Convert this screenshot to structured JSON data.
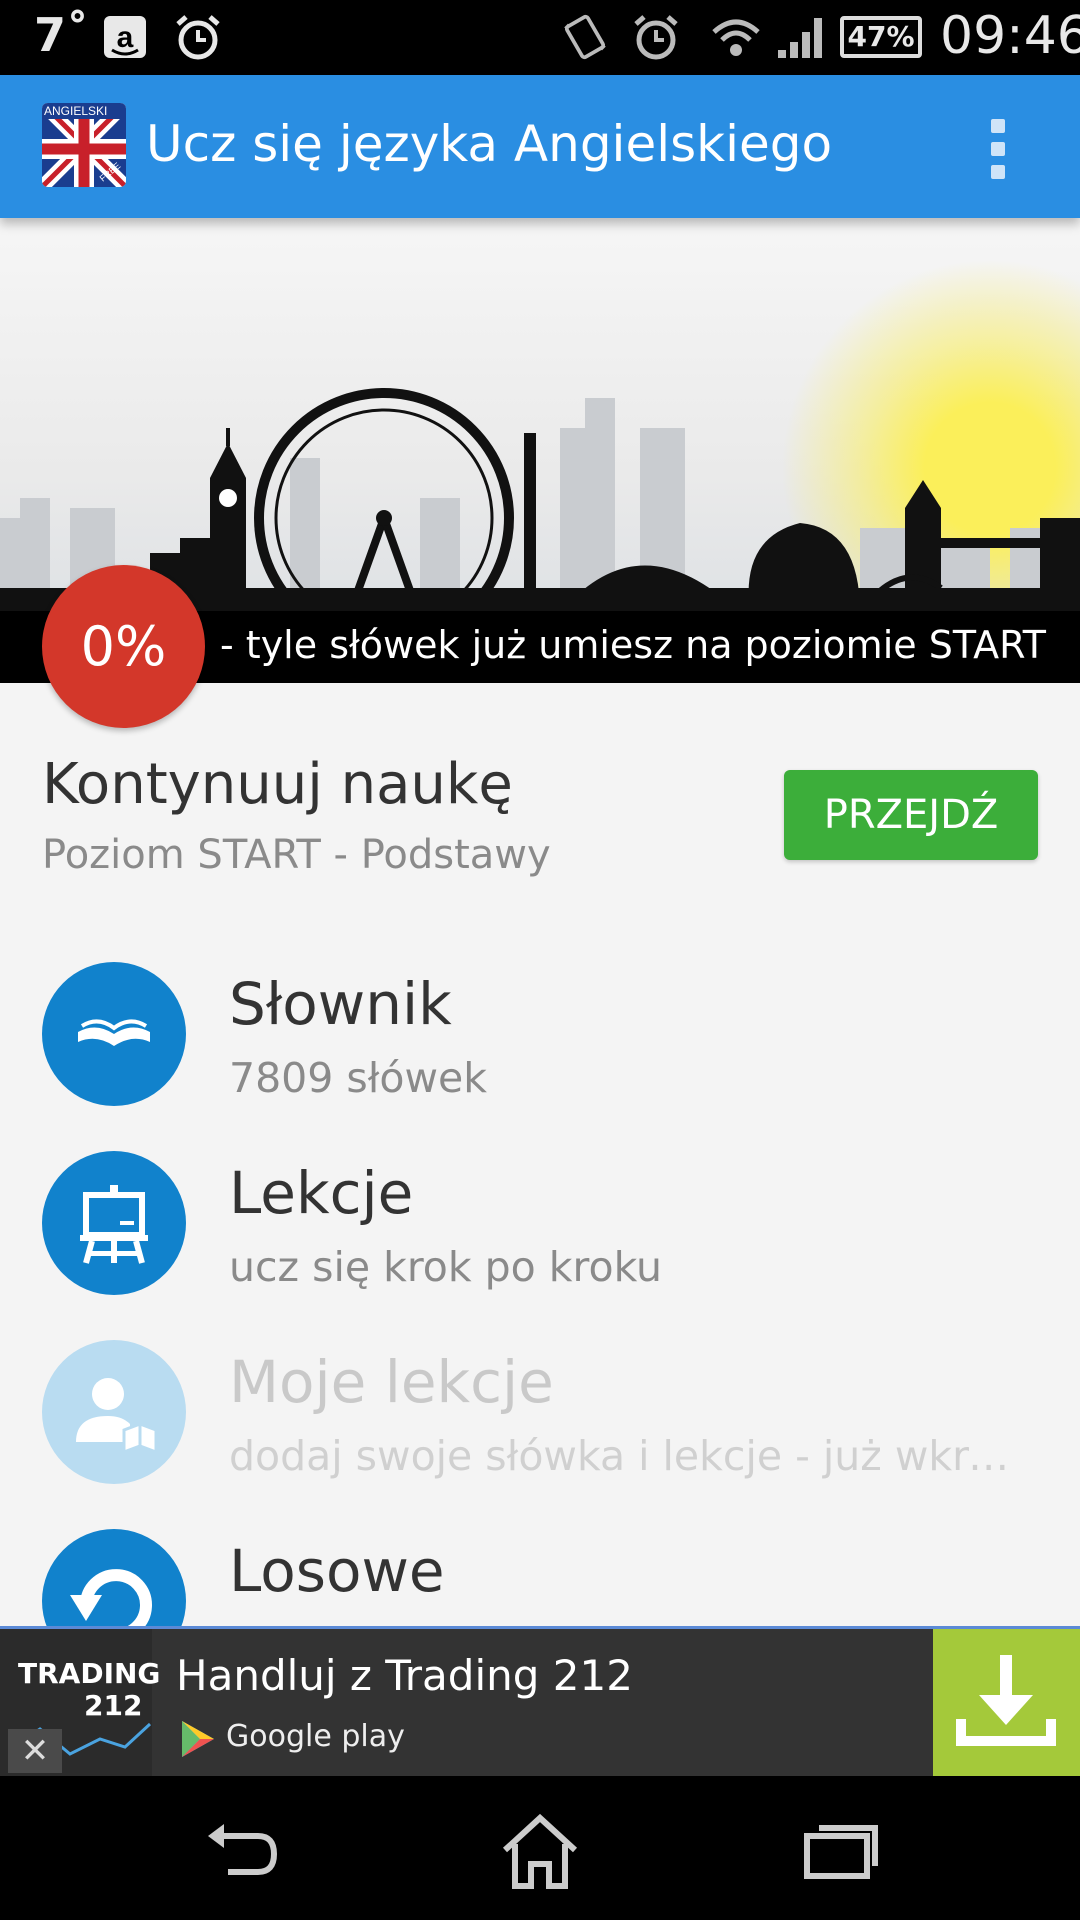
{
  "status_bar": {
    "temperature": "7˚",
    "battery": "47%",
    "time": "09:46",
    "icons": [
      "amazon-icon",
      "alarm-icon",
      "vibrate-icon",
      "alarm-icon",
      "wifi-icon",
      "signal-icon",
      "battery-icon"
    ]
  },
  "app_bar": {
    "logo_text": "ANGIELSKI",
    "logo_badge": "FREE",
    "title": "Ucz się języka Angielskiego",
    "menu_icon": "overflow-menu-icon"
  },
  "hero": {
    "progress_value": "0%",
    "progress_text": "- tyle słówek już umiesz na poziomie START"
  },
  "continue": {
    "title": "Kontynuuj naukę",
    "subtitle": "Poziom START - Podstawy",
    "button_label": "PRZEJDŹ"
  },
  "menu": [
    {
      "title": "Słownik",
      "subtitle": "7809 słówek",
      "icon": "book-icon",
      "enabled": true
    },
    {
      "title": "Lekcje",
      "subtitle": "ucz się krok po kroku",
      "icon": "easel-icon",
      "enabled": true
    },
    {
      "title": "Moje lekcje",
      "subtitle": "dodaj swoje słówka i lekcje - już wkrótce",
      "icon": "user-book-icon",
      "enabled": false
    },
    {
      "title": "Losowe",
      "subtitle": "",
      "icon": "refresh-icon",
      "enabled": true
    }
  ],
  "ad": {
    "logo_line1": "TRADING",
    "logo_line2": "212",
    "title": "Handluj z Trading 212",
    "store": "Google play",
    "icons": [
      "close-icon",
      "google-play-icon",
      "download-icon"
    ]
  },
  "nav_bar": {
    "icons": [
      "back-icon",
      "home-icon",
      "recents-icon"
    ]
  },
  "colors": {
    "app_bar": "#2a8ee2",
    "accent_green": "#3cae3a",
    "progress_red": "#d3372a",
    "icon_blue": "#1182cc",
    "icon_blue_disabled": "#b9dcf1",
    "ad_download": "#a4c93a"
  }
}
